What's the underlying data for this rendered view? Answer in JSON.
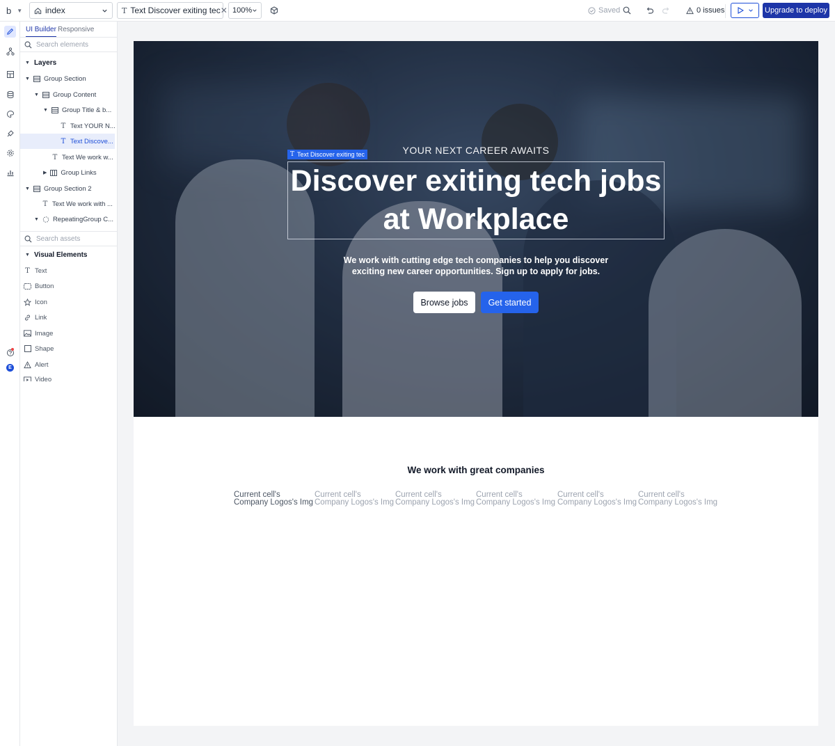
{
  "topbar": {
    "logo": "b",
    "page_selector": "index",
    "element_tab": "Text Discover exiting tec",
    "zoom": "100%",
    "saved": "Saved",
    "issues": "0 issues",
    "deploy": "Upgrade to deploy"
  },
  "panel": {
    "tabs": [
      "UI Builder",
      "Responsive"
    ],
    "search_elements_placeholder": "Search elements",
    "layers_title": "Layers",
    "layers": [
      {
        "label": "Group Section",
        "icon": "group-icon"
      },
      {
        "label": "Group Content",
        "icon": "group-icon"
      },
      {
        "label": "Group Title & b...",
        "icon": "group-icon"
      },
      {
        "label": "Text YOUR N...",
        "icon": "text-icon"
      },
      {
        "label": "Text Discove...",
        "icon": "text-icon"
      },
      {
        "label": "Text We work w...",
        "icon": "text-icon"
      },
      {
        "label": "Group Links",
        "icon": "columns-icon"
      },
      {
        "label": "Group Section 2",
        "icon": "group-icon"
      },
      {
        "label": "Text We work with ...",
        "icon": "text-icon"
      },
      {
        "label": "RepeatingGroup C...",
        "icon": "repeating-group-icon"
      }
    ],
    "search_assets_placeholder": "Search assets",
    "visual_title": "Visual Elements",
    "assets": [
      "Text",
      "Button",
      "Icon",
      "Link",
      "Image",
      "Shape",
      "Alert",
      "Video"
    ]
  },
  "canvas": {
    "eyebrow": "YOUR NEXT CAREER AWAITS",
    "selection_tag": "Text Discover exiting tec",
    "headline": "Discover exiting tech jobs at Workplace",
    "subtitle": "We work with cutting edge tech companies to help you discover exciting new career opportunities. Sign up to apply for jobs.",
    "browse_button": "Browse jobs",
    "start_button": "Get started",
    "companies_title": "We work with great companies",
    "cells": [
      "Current cell's Company Logos's Img",
      "Current cell's Company Logos's Img",
      "Current cell's Company Logos's Img",
      "Current cell's Company Logos's Img",
      "Current cell's Company Logos's Img",
      "Current cell's Company Logos's Img"
    ]
  },
  "colors": {
    "accent": "#2563eb",
    "deploy": "#1d35a8"
  }
}
